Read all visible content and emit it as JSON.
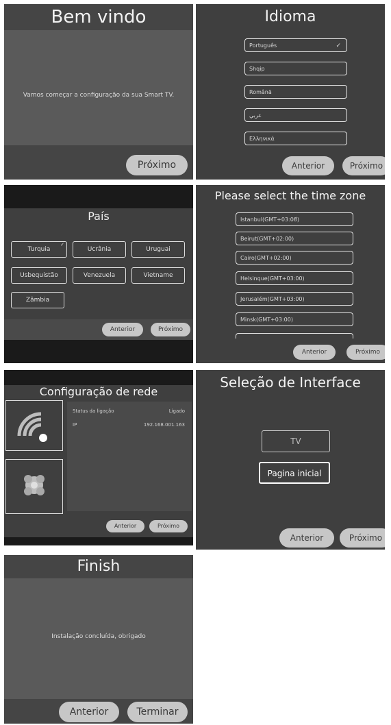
{
  "welcome": {
    "title": "Bem vindo",
    "message": "Vamos começar a configuração da sua Smart TV.",
    "next_label": "Próximo"
  },
  "language": {
    "title": "Idioma",
    "options": [
      "Português",
      "Shqip",
      "Română",
      "عربي",
      "Ελληνικά"
    ],
    "selected_index": 0,
    "prev_label": "Anterior",
    "next_label": "Próximo"
  },
  "country": {
    "title": "País",
    "options": [
      "Turquia",
      "Ucrânia",
      "Uruguai",
      "Usbequistão",
      "Venezuela",
      "Vietname",
      "Zâmbia"
    ],
    "selected_index": 0,
    "prev_label": "Anterior",
    "next_label": "Próximo"
  },
  "timezone": {
    "title": "Please select the time zone",
    "options": [
      "Istanbul(GMT+03:00)",
      "Beirut(GMT+02:00)",
      "Cairo(GMT+02:00)",
      "Helsinque(GMT+03:00)",
      "Jerusalém(GMT+03:00)",
      "Minsk(GMT+03:00)"
    ],
    "selected_index": 0,
    "prev_label": "Anterior",
    "next_label": "Próximo"
  },
  "network": {
    "title": "Configuração de rede",
    "status_label": "Status da ligação",
    "status_value": "Ligado",
    "ip_label": "IP",
    "ip_value": "192.168.001.163",
    "wifi_icon": "wifi-icon",
    "ethernet_icon": "ethernet-icon",
    "prev_label": "Anterior",
    "next_label": "Próximo"
  },
  "interface": {
    "title": "Seleção de Interface",
    "option_tv": "TV",
    "option_home": "Pagina inicial",
    "selected": "option_home",
    "prev_label": "Anterior",
    "next_label": "Próximo"
  },
  "finish": {
    "title": "Finish",
    "message": "Instalação concluída, obrigado",
    "prev_label": "Anterior",
    "finish_label": "Terminar"
  },
  "colors": {
    "panel_bg": "#3f3f3f",
    "header_bg": "#2e2e2e",
    "button_bg": "#c7c7c7"
  }
}
